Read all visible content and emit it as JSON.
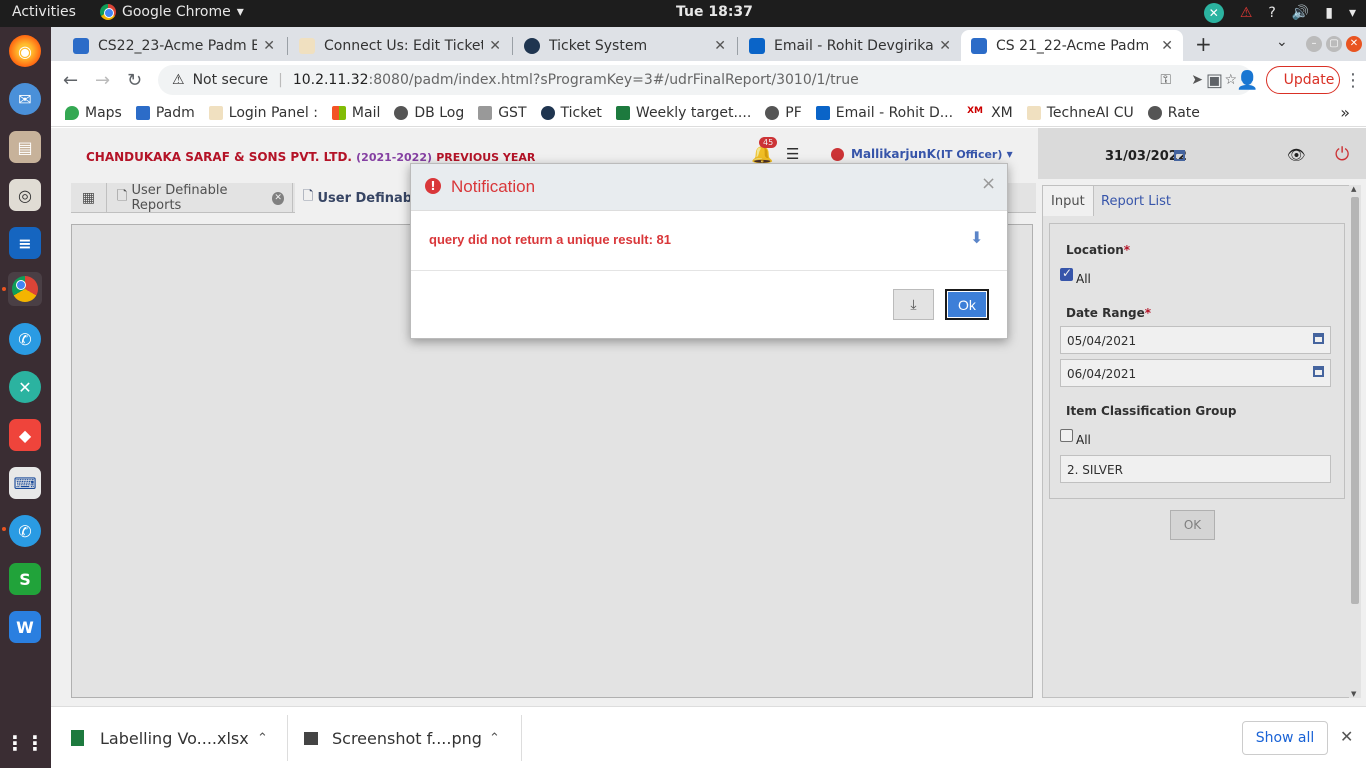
{
  "topbar": {
    "activities": "Activities",
    "app_name": "Google Chrome",
    "clock": "Tue 18:37"
  },
  "tabs": [
    {
      "title": "CS22_23-Acme Padm ERP",
      "active": false
    },
    {
      "title": "Connect Us: Edit Ticket",
      "active": false
    },
    {
      "title": "Ticket System",
      "active": false
    },
    {
      "title": "Email - Rohit Devgirikar",
      "active": false
    },
    {
      "title": "CS 21_22-Acme Padm ERP",
      "active": true
    }
  ],
  "address_bar": {
    "security": "Not secure",
    "host": "10.2.11.32",
    "url_rest": ":8080/padm/index.html?sProgramKey=3#/udrFinalReport/3010/1/true",
    "update_label": "Update"
  },
  "bookmarks": [
    "Maps",
    "Padm",
    "Login Panel :",
    "Mail",
    "DB Log",
    "GST",
    "Ticket",
    "Weekly target....",
    "PF",
    "Email - Rohit D...",
    "XM",
    "TechneAI CU",
    "Rate"
  ],
  "app": {
    "company": "CHANDUKAKA SARAF & SONS PVT. LTD.",
    "year": "(2021-2022)",
    "previous_year": "PREVIOUS YEAR",
    "notification_count": "45",
    "user_name": "MallikarjunK",
    "user_role": "(IT Officer)",
    "date": "31/03/2022",
    "page_tabs": [
      "User Definable Reports",
      "User Definable"
    ]
  },
  "side_panel": {
    "tabs": [
      "Input",
      "Report List"
    ],
    "location_label": "Location",
    "location_all_label": "All",
    "location_all_checked": true,
    "date_range_label": "Date Range",
    "date_from": "05/04/2021",
    "date_to": "06/04/2021",
    "item_group_label": "Item Classification Group",
    "item_group_all_label": "All",
    "item_group_all_checked": false,
    "item_group_value": "2. SILVER",
    "ok_label": "OK"
  },
  "modal": {
    "title": "Notification",
    "message": "query did not return a unique result: 81",
    "ok_label": "Ok",
    "close_glyph": "×"
  },
  "downloads": {
    "items": [
      "Labelling Vo....xlsx",
      "Screenshot f....png"
    ],
    "show_all": "Show all"
  },
  "colors": {
    "accent_red": "#d9373a",
    "ok_blue": "#3d7fd8",
    "company_red": "#c0152a",
    "year_purple": "#8e44ad"
  }
}
